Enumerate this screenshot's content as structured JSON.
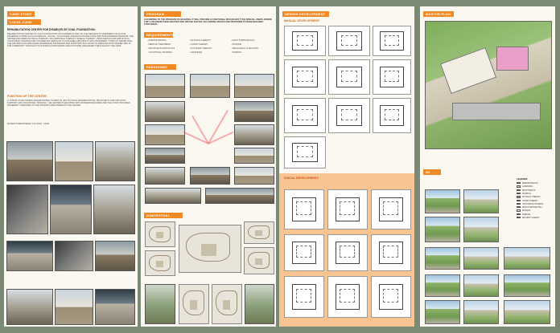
{
  "sheet1": {
    "case_tag": "CASE STUDY :-",
    "local_tag": "LOCAL CASE STUDY",
    "title": "REHABILITATION CENTER FOR DISABLED BY CHAL FOUNDATION:",
    "body": "REHABILITATION CENTER OF CHAL FOUNDATION HAS FORMED IN 2002 ON THE REQUEST BY DIFFERENT NGOS FOR DIFFERENT FORMS SUCH AS MEDICAL, SOCIAL, VOCATIONAL AND EDUCATIONAL FACILITIES FOR DISABLED PERSONS. THE CENTER PROVIDES PHYSICAL THERAPY, OCCUPATIONAL THERAPY, SPEECH THERAPY, PROSTHETICS AND ORTHOTICS, VOCATIONAL TRAINING AND COUNSELING SERVICES TO CHILDREN AND ADULTS WITH DIFFERENT TYPES OF DISABILITIES. THE CENTER ALSO ARRANGES AWARENESS PROGRAMS AND SUPPORTS INCLUSION OF PERSONS WITH DISABILITIES IN THE COMMUNITY THROUGH ITS OUTREACH PROGRAMS AND ACTIVITIES ORGANIZED THROUGHOUT THE YEAR.",
    "function_heading": "FUNCTION OF THE CENTER:",
    "function_body": "IT IS BOTH FUNCTIONING WHERE PATIENT COMES TO GET PHYSICAL REHABILITATION, PROSTHETIC AND ORTHOTIC SUPPORT AND VOCATIONAL TRAINING. THE CENTER IS EQUIPPED WITH MODERN MACHINES AND THE STAFF PROVIDES DIFFERENT THERAPIES TO THE PATIENTS REGISTERED IN THE CENTER.",
    "patients_note": "PATIENTS REGISTERED TILL NOW : 13435"
  },
  "sheet2": {
    "program_tag": "PROGRAM ANALYSIS",
    "program_intro": "ACCORDING TO THE PROGRAM OF BUILDING, IT WILL PROVIDE A FUNCTIONAL SPACES W.R.T THE SPECIAL USERS, WHERE THEY CAN KNOW THEIR ABILITIES AND SPECIALIZATION. FOLLOWING SPACES ARE PROPOSED TO MAKE BUILDING FUNCTIONAL:",
    "requirements_heading": "REQUIREMENTS:",
    "requirements": [
      [
        "- ADMINISTRATION",
        "- PHYSICAL THERAPY",
        "- MULTI PURPOSE HALL"
      ],
      [
        "- MEDICAL TREATMENT",
        "- HYDRO THERAPY",
        "- MOSQUE"
      ],
      [
        "- PROSTHETIC/ORTHOTICS",
        "- OUT DOOR THERAPY",
        "- MECHANICAL & SECURITY"
      ],
      [
        "- VOCATIONAL TRAINING",
        "- CAFETERIA",
        "- PARKING"
      ]
    ],
    "panoramic_tag": "PANAROMIC VIEWS:",
    "contextual_tag": "CONTEXTUAL ANALYSIS:"
  },
  "sheet3": {
    "design_tag": "DESIGN DEVELOPMENT PROCESS",
    "manual_heading": "MANUAL DEVELOPMENT:",
    "digital_heading": "DIGITAL DEVELOPMENT:"
  },
  "sheet4": {
    "master_tag": "MASTER PLAN",
    "views_tag": "3D VIEWS",
    "legend_title": "LEGENDS",
    "legend": [
      {
        "label": "ADMINISTRATION",
        "color": "#e8a0c8"
      },
      {
        "label": "CAFETERIA",
        "color": "#f3e06a"
      },
      {
        "label": "PROSTHETICS",
        "color": "#f5a15b"
      },
      {
        "label": "HOSPITAL",
        "color": "#ffffff"
      },
      {
        "label": "PHYSICAL THERAPY",
        "color": "#d87ad0"
      },
      {
        "label": "HYDRO THERAPY",
        "color": "#7fc3e6"
      },
      {
        "label": "VOCATIONAL TRAINING",
        "color": "#b9e07a"
      },
      {
        "label": "MULTI PURPOSE HALL",
        "color": "#c9b3e6"
      },
      {
        "label": "MOSQUE",
        "color": "#f2f2f2"
      },
      {
        "label": "PARKING",
        "color": "#bfbfbf"
      },
      {
        "label": "SECURITY & MECH",
        "color": "#9fb1c9"
      }
    ]
  },
  "colors": {
    "accent": "#f08a25",
    "panel": "#f8c592",
    "background": "#7b8a74"
  }
}
